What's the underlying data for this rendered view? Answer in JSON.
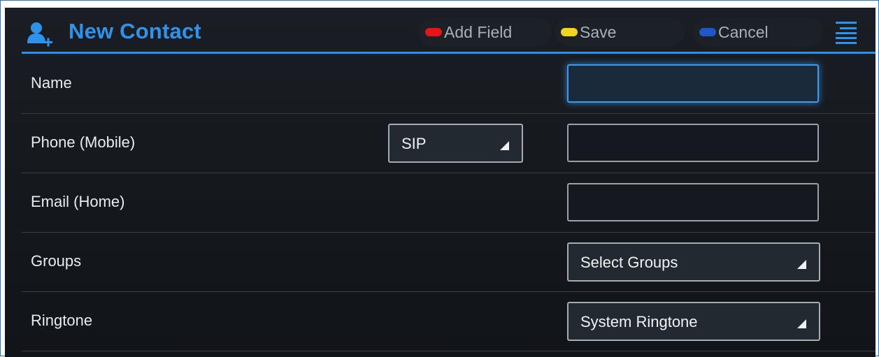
{
  "header": {
    "title": "New Contact",
    "title_icon": "add-contact-icon",
    "accent_color": "#2f93ec"
  },
  "softkeys": [
    {
      "label": "Add Field",
      "color": "#e8141a"
    },
    {
      "label": "Save",
      "color": "#f2d41b"
    },
    {
      "label": "Cancel",
      "color": "#1f56c9"
    }
  ],
  "menu_icon": "menu-lines-icon",
  "form": {
    "name": {
      "label": "Name",
      "value": ""
    },
    "phone": {
      "label": "Phone (Mobile)",
      "type_selected": "SIP",
      "value": ""
    },
    "email": {
      "label": "Email (Home)",
      "value": ""
    },
    "groups": {
      "label": "Groups",
      "selected": "Select Groups"
    },
    "ringtone": {
      "label": "Ringtone",
      "selected": "System Ringtone"
    }
  }
}
